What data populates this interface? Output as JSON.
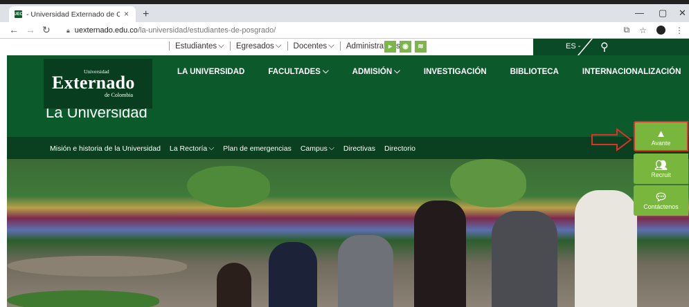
{
  "browser": {
    "tab_title": "- Universidad Externado de Colo",
    "favicon_text": "UEC",
    "tab_close": "×",
    "new_tab": "+",
    "window_controls": [
      "—",
      "▢",
      "✕"
    ],
    "url_host": "uexternado.edu.co",
    "url_path": "/la-universidad/estudiantes-de-posgrado/"
  },
  "site": {
    "top_links": [
      {
        "label": "Estudiantes",
        "dropdown": true
      },
      {
        "label": "Egresados",
        "dropdown": true
      },
      {
        "label": "Docentes",
        "dropdown": true
      },
      {
        "label": "Administrativos",
        "dropdown": false
      }
    ],
    "lang": "ES -",
    "logo": {
      "top": "Universidad",
      "main": "Externado",
      "bottom": "de Colombia"
    },
    "nav": [
      {
        "label": "LA UNIVERSIDAD",
        "dropdown": false
      },
      {
        "label": "FACULTADES",
        "dropdown": true
      },
      {
        "label": "ADMISIÓN",
        "dropdown": true
      },
      {
        "label": "INVESTIGACIÓN",
        "dropdown": false
      },
      {
        "label": "BIBLIOTECA",
        "dropdown": false
      },
      {
        "label": "INTERNACIONALIZACIÓN",
        "dropdown": false
      }
    ],
    "page_title": "La Universidad",
    "subnav": [
      {
        "label": "Misión e historia de la Universidad",
        "dropdown": false
      },
      {
        "label": "La Rectoría",
        "dropdown": true
      },
      {
        "label": "Plan de emergencias",
        "dropdown": false
      },
      {
        "label": "Campus",
        "dropdown": true
      },
      {
        "label": "Directivas",
        "dropdown": false
      },
      {
        "label": "Directorio",
        "dropdown": false
      }
    ],
    "side_buttons": {
      "avante": "Avante",
      "recruit": "Recruit",
      "contact": "Contáctenos"
    }
  },
  "colors": {
    "green_dark": "#0a3f1f",
    "green_main": "#0c5a2c",
    "side_green": "#78b63e",
    "highlight_red": "#e0322b"
  }
}
